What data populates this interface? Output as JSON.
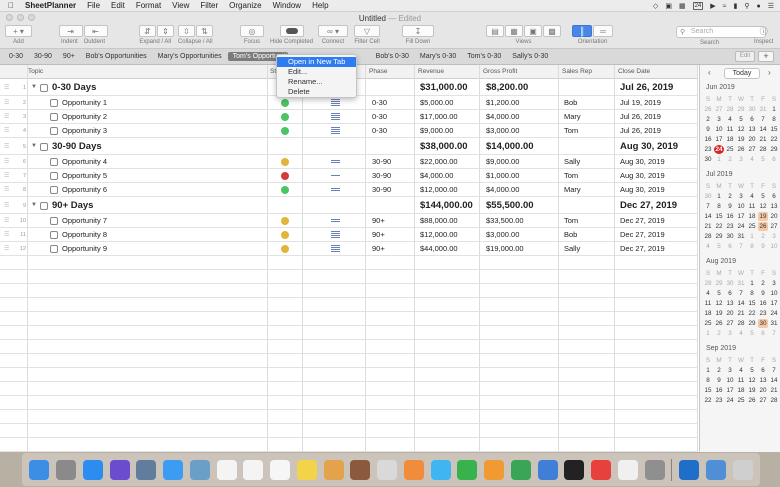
{
  "menubar": {
    "app": "SheetPlanner",
    "items": [
      "File",
      "Edit",
      "Format",
      "View",
      "Filter",
      "Organize",
      "Window",
      "Help"
    ],
    "clock_day": "24"
  },
  "window": {
    "title": "Untitled",
    "status": "— Edited"
  },
  "toolbar": {
    "add": "Add",
    "indent": "Indent",
    "outdent": "Outdent",
    "expand_collapse": "Expand / All",
    "collapse_all": "Collapse / All",
    "focus": "Focus",
    "hide_completed": "Hide Completed",
    "connect": "Connect",
    "filter_cell": "Filter Cell",
    "fill_down": "Fill Down",
    "views": "Views",
    "orientation": "Orientation",
    "search": "Search",
    "search_placeholder": "Search",
    "inspect": "Inspect"
  },
  "tabs": [
    "0-30",
    "30-90",
    "90+",
    "Bob's Opportunities",
    "Mary's Opportunities",
    "Tom's Opportunities",
    "Bob's 0-30",
    "Mary's 0-30",
    "Tom's 0-30",
    "Sally's 0-30"
  ],
  "tab_edit": "Edit",
  "columns": {
    "topic": "Topic",
    "status": "St",
    "phase": "Phase",
    "revenue": "Revenue",
    "gross_profit": "Gross Profit",
    "sales_rep": "Sales Rep",
    "close_date": "Close Date"
  },
  "rows": [
    {
      "num": "1",
      "type": "group",
      "topic": "0-30 Days",
      "revenue": "$31,000.00",
      "gp": "$8,200.00",
      "date": "Jul 26, 2019"
    },
    {
      "num": "2",
      "type": "item",
      "topic": "Opportunity 1",
      "status": "#4cc463",
      "phase": "0-30",
      "revenue": "$5,000.00",
      "gp": "$1,200.00",
      "rep": "Bob",
      "date": "Jul 19, 2019",
      "pri": 4
    },
    {
      "num": "3",
      "type": "item",
      "topic": "Opportunity 2",
      "status": "#4cc463",
      "phase": "0-30",
      "revenue": "$17,000.00",
      "gp": "$4,000.00",
      "rep": "Mary",
      "date": "Jul 26, 2019",
      "pri": 4
    },
    {
      "num": "4",
      "type": "item",
      "topic": "Opportunity 3",
      "status": "#4cc463",
      "phase": "0-30",
      "revenue": "$9,000.00",
      "gp": "$3,000.00",
      "rep": "Tom",
      "date": "Jul 26, 2019",
      "pri": 4
    },
    {
      "num": "5",
      "type": "group",
      "topic": "30-90 Days",
      "revenue": "$38,000.00",
      "gp": "$14,000.00",
      "date": "Aug 30, 2019"
    },
    {
      "num": "6",
      "type": "item",
      "topic": "Opportunity 4",
      "status": "#e2b43c",
      "phase": "30-90",
      "revenue": "$22,000.00",
      "gp": "$9,000.00",
      "rep": "Sally",
      "date": "Aug 30, 2019",
      "pri": 2
    },
    {
      "num": "7",
      "type": "item",
      "topic": "Opportunity 5",
      "status": "#d33c3c",
      "phase": "30-90",
      "revenue": "$4,000.00",
      "gp": "$1,000.00",
      "rep": "Tom",
      "date": "Aug 30, 2019",
      "pri": 1
    },
    {
      "num": "8",
      "type": "item",
      "topic": "Opportunity 6",
      "status": "#4cc463",
      "phase": "30-90",
      "revenue": "$12,000.00",
      "gp": "$4,000.00",
      "rep": "Mary",
      "date": "Aug 30, 2019",
      "pri": 2
    },
    {
      "num": "9",
      "type": "group",
      "topic": "90+ Days",
      "revenue": "$144,000.00",
      "gp": "$55,500.00",
      "date": "Dec 27, 2019"
    },
    {
      "num": "10",
      "type": "item",
      "topic": "Opportunity 7",
      "status": "#e2b43c",
      "phase": "90+",
      "revenue": "$88,000.00",
      "gp": "$33,500.00",
      "rep": "Tom",
      "date": "Dec 27, 2019",
      "pri": 2
    },
    {
      "num": "11",
      "type": "item",
      "topic": "Opportunity 8",
      "status": "#e2b43c",
      "phase": "90+",
      "revenue": "$12,000.00",
      "gp": "$3,000.00",
      "rep": "Bob",
      "date": "Dec 27, 2019",
      "pri": 4
    },
    {
      "num": "12",
      "type": "item",
      "topic": "Opportunity 9",
      "status": "#e2b43c",
      "phase": "90+",
      "revenue": "$44,000.00",
      "gp": "$19,000.00",
      "rep": "Sally",
      "date": "Dec 27, 2019",
      "pri": 4
    }
  ],
  "context_menu": [
    "Open in New Tab",
    "Edit...",
    "Rename...",
    "Delete"
  ],
  "calendar": {
    "today_label": "Today",
    "weekdays": [
      "S",
      "M",
      "T",
      "W",
      "T",
      "F",
      "S"
    ],
    "months": [
      {
        "name": "Jun 2019",
        "weeks": [
          [
            "26",
            "27",
            "28",
            "29",
            "30",
            "31",
            "1"
          ],
          [
            "2",
            "3",
            "4",
            "5",
            "6",
            "7",
            "8"
          ],
          [
            "9",
            "10",
            "11",
            "12",
            "13",
            "14",
            "15"
          ],
          [
            "16",
            "17",
            "18",
            "19",
            "20",
            "21",
            "22"
          ],
          [
            "23",
            "24",
            "25",
            "26",
            "27",
            "28",
            "29"
          ],
          [
            "30",
            "1",
            "2",
            "3",
            "4",
            "5",
            "6"
          ]
        ],
        "today": "24"
      },
      {
        "name": "Jul 2019",
        "weeks": [
          [
            "30",
            "1",
            "2",
            "3",
            "4",
            "5",
            "6"
          ],
          [
            "7",
            "8",
            "9",
            "10",
            "11",
            "12",
            "13"
          ],
          [
            "14",
            "15",
            "16",
            "17",
            "18",
            "19",
            "20"
          ],
          [
            "21",
            "22",
            "23",
            "24",
            "25",
            "26",
            "27"
          ],
          [
            "28",
            "29",
            "30",
            "31",
            "1",
            "2",
            "3"
          ],
          [
            "4",
            "5",
            "6",
            "7",
            "8",
            "9",
            "10"
          ]
        ],
        "marked": [
          "19",
          "26"
        ]
      },
      {
        "name": "Aug 2019",
        "weeks": [
          [
            "28",
            "29",
            "30",
            "31",
            "1",
            "2",
            "3"
          ],
          [
            "4",
            "5",
            "6",
            "7",
            "8",
            "9",
            "10"
          ],
          [
            "11",
            "12",
            "13",
            "14",
            "15",
            "16",
            "17"
          ],
          [
            "18",
            "19",
            "20",
            "21",
            "22",
            "23",
            "24"
          ],
          [
            "25",
            "26",
            "27",
            "28",
            "29",
            "30",
            "31"
          ],
          [
            "1",
            "2",
            "3",
            "4",
            "5",
            "6",
            "7"
          ]
        ],
        "marked": [
          "30"
        ]
      },
      {
        "name": "Sep 2019",
        "weeks": [
          [
            "1",
            "2",
            "3",
            "4",
            "5",
            "6",
            "7"
          ],
          [
            "8",
            "9",
            "10",
            "11",
            "12",
            "13",
            "14"
          ],
          [
            "15",
            "16",
            "17",
            "18",
            "19",
            "20",
            "21"
          ],
          [
            "22",
            "23",
            "24",
            "25",
            "26",
            "27",
            "28"
          ]
        ]
      }
    ]
  },
  "dock": [
    {
      "name": "finder",
      "color": "#3a8ee6"
    },
    {
      "name": "system-preferences",
      "color": "#8a8a8a"
    },
    {
      "name": "app-store",
      "color": "#2d8cf0"
    },
    {
      "name": "siri",
      "color": "#6a4ccf"
    },
    {
      "name": "launchpad",
      "color": "#607d9e"
    },
    {
      "name": "safari",
      "color": "#3b9cf2"
    },
    {
      "name": "preview",
      "color": "#6aa0c8"
    },
    {
      "name": "calendar",
      "color": "#f4f4f4"
    },
    {
      "name": "calendar-2",
      "color": "#f4f4f4"
    },
    {
      "name": "reminders",
      "color": "#f6f6f6"
    },
    {
      "name": "notes",
      "color": "#f2d34a"
    },
    {
      "name": "sheetplanner",
      "color": "#e2a34a"
    },
    {
      "name": "mosaic",
      "color": "#8b5a3c"
    },
    {
      "name": "script-editor",
      "color": "#d9d9d9"
    },
    {
      "name": "photos",
      "color": "#f08c3c"
    },
    {
      "name": "messages",
      "color": "#3fb6f2"
    },
    {
      "name": "facetime",
      "color": "#37b24d"
    },
    {
      "name": "pages",
      "color": "#f09a34"
    },
    {
      "name": "numbers",
      "color": "#3aa655"
    },
    {
      "name": "keynote",
      "color": "#3f7fd8"
    },
    {
      "name": "stocks",
      "color": "#222222"
    },
    {
      "name": "news",
      "color": "#e8413c"
    },
    {
      "name": "music",
      "color": "#f0f0f0"
    },
    {
      "name": "notefile",
      "color": "#8f8f8f"
    },
    {
      "name": "outlook",
      "color": "#1f6fc8"
    },
    {
      "name": "downloads",
      "color": "#4f8fd6"
    },
    {
      "name": "trash",
      "color": "#cfcfcf"
    }
  ]
}
